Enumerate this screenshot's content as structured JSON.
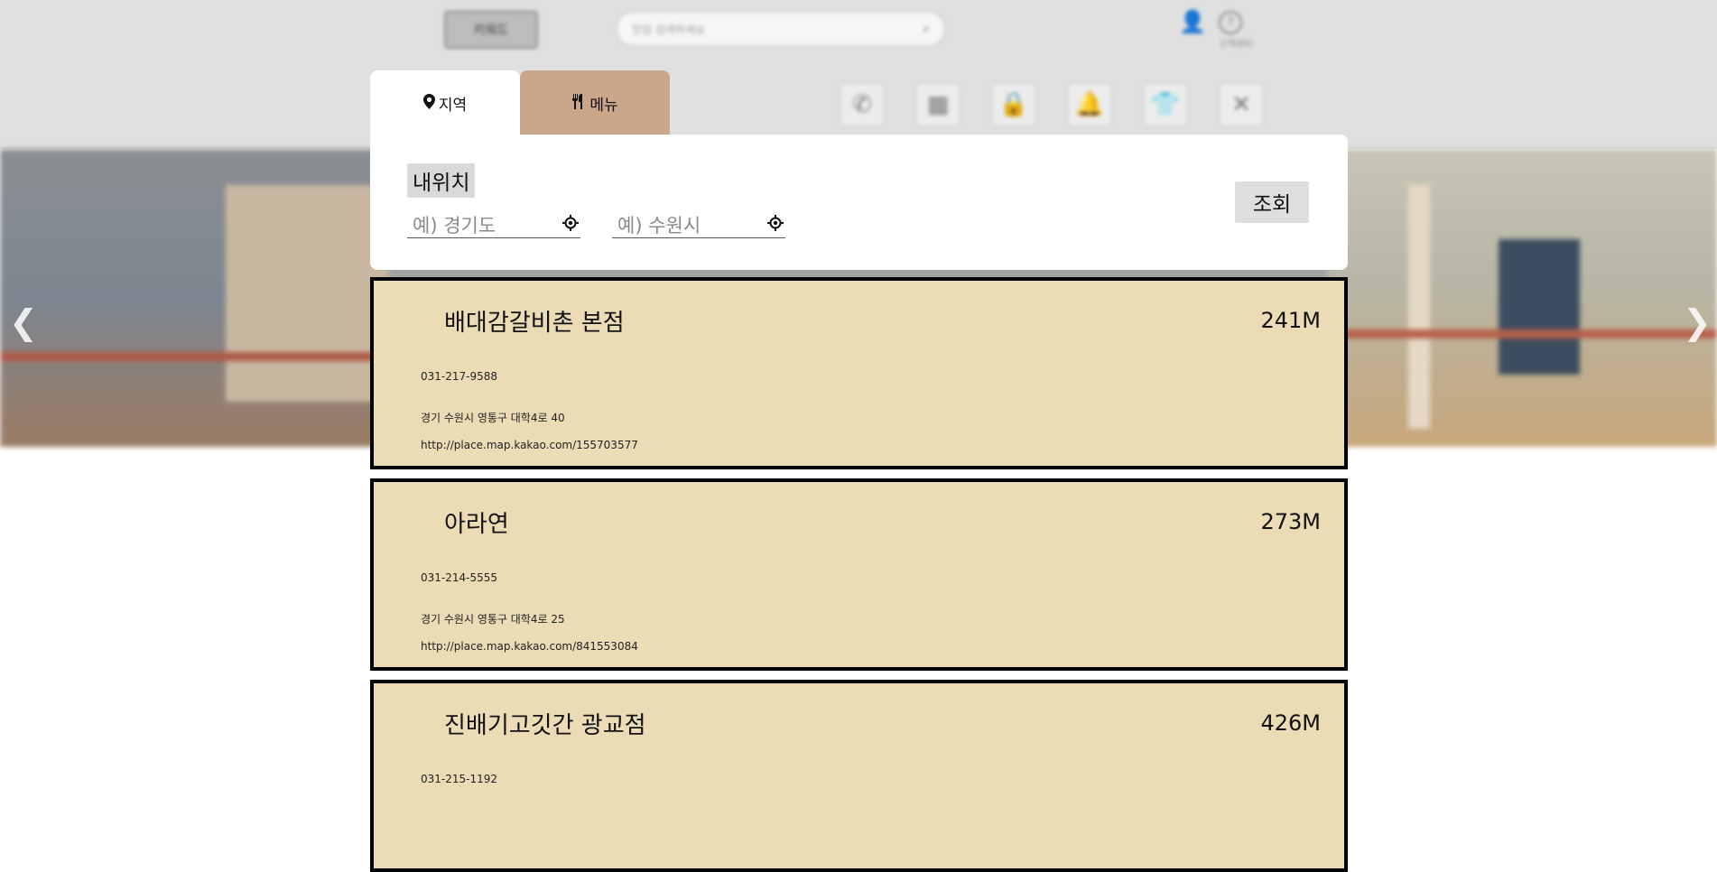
{
  "header": {
    "logo_text": "키워드",
    "search_placeholder": "맛집 검색하세요",
    "help_label": "고객센터"
  },
  "category_icons": [
    "phone-icon",
    "store-icon",
    "lock-icon",
    "bell-icon",
    "shirt-icon",
    "close-icon"
  ],
  "banner": {
    "prev_arrow": "❮",
    "next_arrow": "❯"
  },
  "tabs": [
    {
      "label": "지역",
      "icon": "map-marker-icon",
      "active": true
    },
    {
      "label": "메뉴",
      "icon": "utensils-icon",
      "active": false
    }
  ],
  "search_panel": {
    "my_location_label": "내위치",
    "province_placeholder": "예) 경기도",
    "city_placeholder": "예) 수원시",
    "query_button": "조회"
  },
  "results": [
    {
      "name": "배대감갈비촌 본점",
      "distance": "241M",
      "phone": "031-217-9588",
      "address": "경기 수원시 영통구 대학4로 40",
      "url": "http://place.map.kakao.com/155703577"
    },
    {
      "name": "아라연",
      "distance": "273M",
      "phone": "031-214-5555",
      "address": "경기 수원시 영통구 대학4로 25",
      "url": "http://place.map.kakao.com/841553084"
    },
    {
      "name": "진배기고깃간 광교점",
      "distance": "426M",
      "phone": "031-215-1192",
      "address": "",
      "url": ""
    }
  ]
}
